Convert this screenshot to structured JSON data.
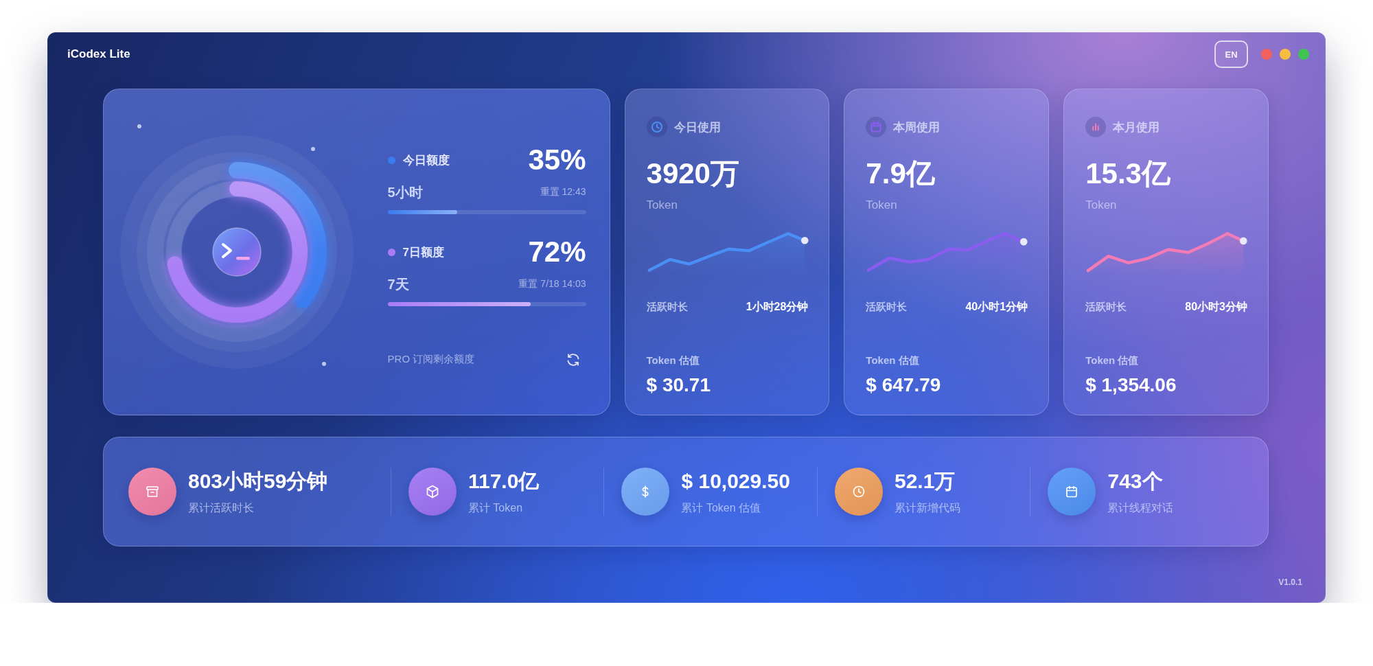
{
  "window": {
    "title": "iCodex Lite",
    "language_button": "EN",
    "version": "V1.0.1"
  },
  "quota_panel": {
    "quotas": [
      {
        "label": "今日额度",
        "percent": "35%",
        "period": "5小时",
        "reset": "重置 12:43",
        "level": 0.35,
        "color": "#3b7cf0"
      },
      {
        "label": "7日额度",
        "percent": "72%",
        "period": "7天",
        "reset": "重置 7/18 14:03",
        "level": 0.72,
        "color": "#a97cf6"
      }
    ],
    "subscription_label": "PRO 订阅剩余额度"
  },
  "usage_cards": [
    {
      "title": "今日使用",
      "value": "3920万",
      "unit": "Token",
      "active_label": "活跃时长",
      "active_time": "1小时28分钟",
      "estimate_label": "Token 估值",
      "estimate": "$ 30.71",
      "color": "#4a8ff5"
    },
    {
      "title": "本周使用",
      "value": "7.9亿",
      "unit": "Token",
      "active_label": "活跃时长",
      "active_time": "40小时1分钟",
      "estimate_label": "Token 估值",
      "estimate": "$ 647.79",
      "color": "#8b5cf0"
    },
    {
      "title": "本月使用",
      "value": "15.3亿",
      "unit": "Token",
      "active_label": "活跃时长",
      "active_time": "80小时3分钟",
      "estimate_label": "Token 估值",
      "estimate": "$ 1,354.06",
      "color": "#f47cb6"
    }
  ],
  "totals": [
    {
      "value": "803小时59分钟",
      "label": "累计活跃时长",
      "color": "#f07ca4"
    },
    {
      "value": "117.0亿",
      "label": "累计 Token",
      "color": "#9b6ff2"
    },
    {
      "value": "$ 10,029.50",
      "label": "累计 Token 估值",
      "color": "#6ea5f8"
    },
    {
      "value": "52.1万",
      "label": "累计新增代码",
      "color": "#ef9d5a"
    },
    {
      "value": "743个",
      "label": "累计线程对话",
      "color": "#4f92f7"
    }
  ]
}
